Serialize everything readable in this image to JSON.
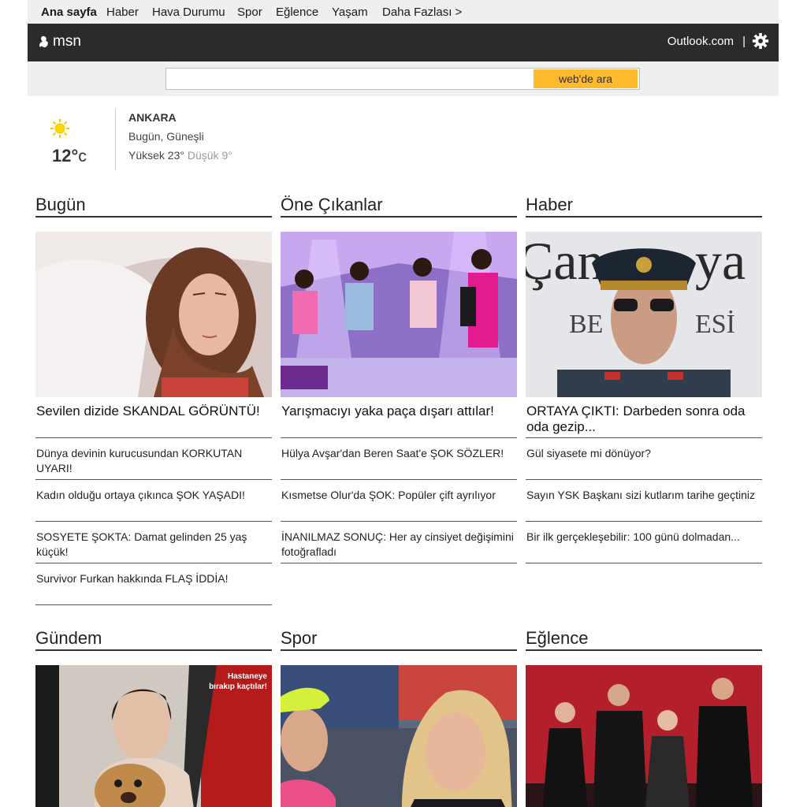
{
  "topnav": [
    "Ana sayfa",
    "Haber",
    "Hava Durumu",
    "Spor",
    "Eğlence",
    "Yaşam",
    "Daha Fazlası >"
  ],
  "header": {
    "logo": "msn",
    "outlook": "Outlook.com",
    "separator": "|"
  },
  "search": {
    "placeholder": "",
    "button": "web'de ara"
  },
  "weather": {
    "city": "ANKARA",
    "temp": "12°",
    "unit": "c",
    "condition": "Bugün, Güneşli",
    "high": "Yüksek 23°",
    "low": "Düşük 9°"
  },
  "sections": [
    {
      "title": "Bugün",
      "lead": "Sevilen dizide SKANDAL GÖRÜNTÜ!",
      "items": [
        "Dünya devinin kurucusundan KORKUTAN UYARI!",
        "Kadın olduğu ortaya çıkınca ŞOK YAŞADI!",
        "SOSYETE ŞOKTA: Damat gelinden 25 yaş küçük!",
        "Survivor Furkan hakkında FLAŞ İDDİA!"
      ]
    },
    {
      "title": "Öne Çıkanlar",
      "lead": "Yarışmacıyı yaka paça dışarı attılar!",
      "items": [
        "Hülya Avşar'dan Beren Saat'e ŞOK SÖZLER!",
        "Kısmetse Olur'da ŞOK: Popüler çift ayrılıyor",
        "İNANILMAZ SONUÇ: Her ay cinsiyet değişimini fotoğrafladı"
      ]
    },
    {
      "title": "Haber",
      "lead": "ORTAYA ÇIKTI: Darbeden sonra oda oda gezip...",
      "items": [
        "Gül siyasete mi dönüyor?",
        "Sayın YSK Başkanı sizi kutlarım tarihe geçtiniz",
        "Bir ilk gerçekleşebilir: 100 günü dolmadan..."
      ]
    },
    {
      "title": "Gündem",
      "image_text": "Hastaneye bırakıp kaçtılar!"
    },
    {
      "title": "Spor"
    },
    {
      "title": "Eğlence"
    }
  ],
  "colors": {
    "accent": "#ffb92c",
    "header_bg": "#2b2b2b",
    "nav_bg": "#efefef"
  }
}
